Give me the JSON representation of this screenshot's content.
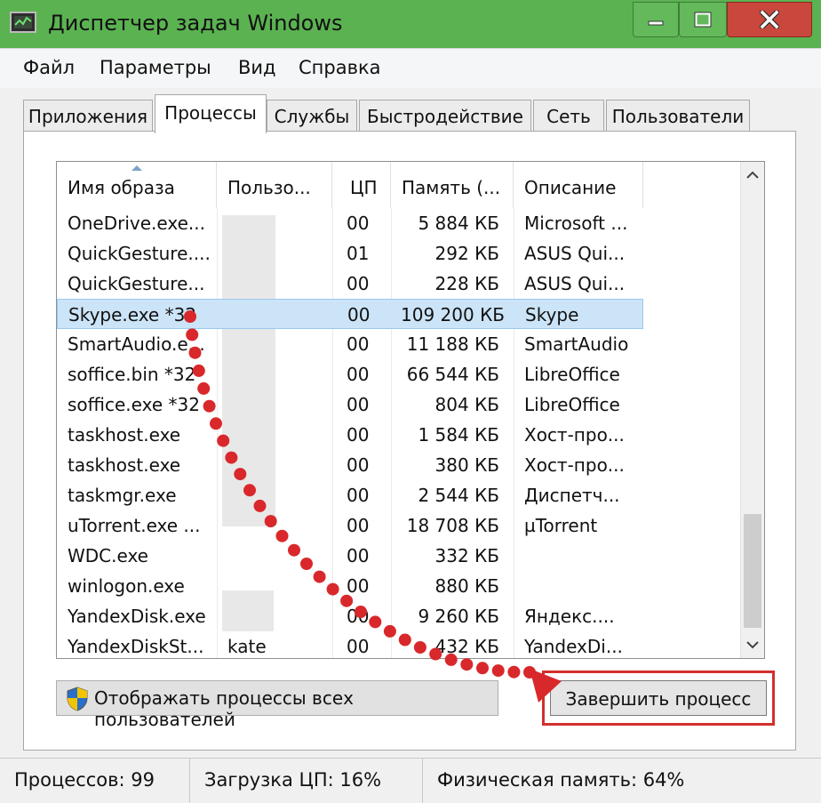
{
  "window": {
    "title": "Диспетчер задач Windows",
    "colors": {
      "titlebar": "#5bb251",
      "close": "#c9473c",
      "highlight": "#d3302c"
    }
  },
  "menu": [
    "Файл",
    "Параметры",
    "Вид",
    "Справка"
  ],
  "tabs": [
    "Приложения",
    "Процессы",
    "Службы",
    "Быстродействие",
    "Сеть",
    "Пользователи"
  ],
  "active_tab": "Процессы",
  "columns": [
    "Имя образа",
    "Пользо...",
    "ЦП",
    "Память (...",
    "Описание"
  ],
  "processes": [
    {
      "name": "OneDrive.exe...",
      "user": "",
      "cpu": "00",
      "mem": "5 884 КБ",
      "desc": "Microsoft ..."
    },
    {
      "name": "QuickGesture....",
      "user": "",
      "cpu": "01",
      "mem": "292 КБ",
      "desc": "ASUS Qui..."
    },
    {
      "name": "QuickGesture...",
      "user": "",
      "cpu": "00",
      "mem": "228 КБ",
      "desc": "ASUS Qui..."
    },
    {
      "name": "Skype.exe *32",
      "user": "",
      "cpu": "00",
      "mem": "109 200 КБ",
      "desc": "Skype"
    },
    {
      "name": "SmartAudio.e...",
      "user": "",
      "cpu": "00",
      "mem": "11 188 КБ",
      "desc": "SmartAudio"
    },
    {
      "name": "soffice.bin *32",
      "user": "",
      "cpu": "00",
      "mem": "66 544 КБ",
      "desc": "LibreOffice"
    },
    {
      "name": "soffice.exe *32",
      "user": "",
      "cpu": "00",
      "mem": "804 КБ",
      "desc": "LibreOffice"
    },
    {
      "name": "taskhost.exe",
      "user": "",
      "cpu": "00",
      "mem": "1 584 КБ",
      "desc": "Хост-про..."
    },
    {
      "name": "taskhost.exe",
      "user": "",
      "cpu": "00",
      "mem": "380 КБ",
      "desc": "Хост-про..."
    },
    {
      "name": "taskmgr.exe",
      "user": "",
      "cpu": "00",
      "mem": "2 544 КБ",
      "desc": "Диспетч..."
    },
    {
      "name": "uTorrent.exe ...",
      "user": "",
      "cpu": "00",
      "mem": "18 708 КБ",
      "desc": "µTorrent"
    },
    {
      "name": "WDC.exe",
      "user": "",
      "cpu": "00",
      "mem": "332 КБ",
      "desc": ""
    },
    {
      "name": "winlogon.exe",
      "user": "",
      "cpu": "00",
      "mem": "880 КБ",
      "desc": ""
    },
    {
      "name": "YandexDisk.exe",
      "user": "",
      "cpu": "00",
      "mem": "9 260 КБ",
      "desc": "Яндекс...."
    },
    {
      "name": "YandexDiskSt...",
      "user": "kate",
      "cpu": "00",
      "mem": "432 КБ",
      "desc": "YandexDi..."
    }
  ],
  "selected_process": "Skype.exe *32",
  "buttons": {
    "show_all": "Отображать процессы всех пользователей",
    "end_process": "Завершить процесс"
  },
  "status": {
    "processes": "Процессов: 99",
    "cpu": "Загрузка ЦП: 16%",
    "memory": "Физическая память: 64%"
  },
  "icons": [
    "app-icon",
    "minimize-icon",
    "maximize-icon",
    "close-icon",
    "sort-up-icon",
    "scroll-up-icon",
    "scroll-down-icon",
    "shield-icon"
  ]
}
